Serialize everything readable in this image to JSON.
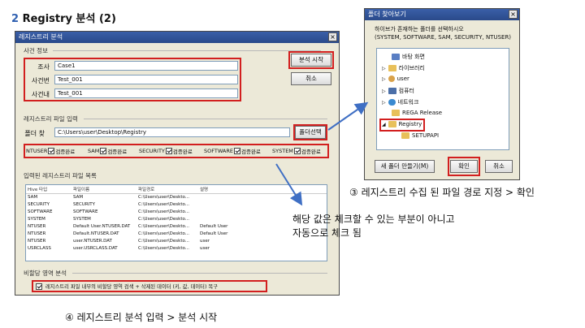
{
  "slide": {
    "title_num": "2",
    "title_text": "Registry 분석 (2)"
  },
  "main_window": {
    "title": "레지스트리 분석",
    "case_group_label": "사건 정보",
    "fields": [
      {
        "label": "조사",
        "value": "Case1"
      },
      {
        "label": "사건번",
        "value": "Test_001"
      },
      {
        "label": "사건내",
        "value": "Test_001"
      }
    ],
    "start_button": "분석 시작",
    "cancel_button": "취소",
    "input_group_label": "레지스트리 파일 입력",
    "folder_label": "폴더 찾",
    "folder_path": "C:\\Users\\user\\Desktop\\Registry",
    "folder_select_button": "폴더선택",
    "checks": [
      {
        "name": "NTUSER",
        "status": "검증완료"
      },
      {
        "name": "SAM",
        "status": "검증완료"
      },
      {
        "name": "SECURITY",
        "status": "검증완료"
      },
      {
        "name": "SOFTWARE",
        "status": "검증완료"
      },
      {
        "name": "SYSTEM",
        "status": "검증완료"
      }
    ],
    "list_group_label": "입력된 레지스트리 파일 목록",
    "list_headers": [
      "Hive 타입",
      "파일이름",
      "파일경로",
      "설명"
    ],
    "list_rows": [
      [
        "SAM",
        "SAM",
        "C:\\Users\\user\\Deskto...",
        ""
      ],
      [
        "SECURITY",
        "SECURITY",
        "C:\\Users\\user\\Deskto...",
        ""
      ],
      [
        "SOFTWARE",
        "SOFTWARE",
        "C:\\Users\\user\\Deskto...",
        ""
      ],
      [
        "SYSTEM",
        "SYSTEM",
        "C:\\Users\\user\\Deskto...",
        ""
      ],
      [
        "NTUSER",
        "Default User.NTUSER.DAT",
        "C:\\Users\\user\\Deskto...",
        "Default User"
      ],
      [
        "NTUSER",
        "Default.NTUSER.DAT",
        "C:\\Users\\user\\Deskto...",
        "Default User"
      ],
      [
        "NTUSER",
        "user.NTUSER.DAT",
        "C:\\Users\\user\\Deskto...",
        "user"
      ],
      [
        "USRCLASS",
        "user.USRCLASS.DAT",
        "C:\\Users\\user\\Deskto...",
        "user"
      ]
    ],
    "unalloc_group_label": "비할당 영역 분석",
    "unalloc_option": "레지스트리 파일 내부의 비할당 영역 검색 + 삭제된 데이터 (키, 값, 데이터) 복구"
  },
  "folder_dialog": {
    "title": "폴더 찾아보기",
    "instruction_1": "하이브가 존재하는 폴더를 선택하시오",
    "instruction_2": "(SYSTEM, SOFTWARE, SAM, SECURITY, NTUSER)",
    "tree": [
      "바탕 화면",
      "라이브러리",
      "user",
      "컴퓨터",
      "네트워크",
      "REGA Release",
      "Registry",
      "SETUPAPI"
    ],
    "new_folder_button": "새 폴더 만들기(M)",
    "ok_button": "확인",
    "cancel_button": "취소"
  },
  "captions": {
    "step3": "③ 레지스트리 수집 된 파일 경로 지정 > 확인",
    "note_line1": "해당 값은 체크할 수 있는 부분이 아니고",
    "note_line2": "자동으로 체크 됨",
    "step4": "④ 레지스트리 분석 입력 > 분석 시작"
  },
  "colors": {
    "highlight": "#d21f1f",
    "arrow": "#3f6fc4",
    "title_num": "#2e5fb0"
  }
}
